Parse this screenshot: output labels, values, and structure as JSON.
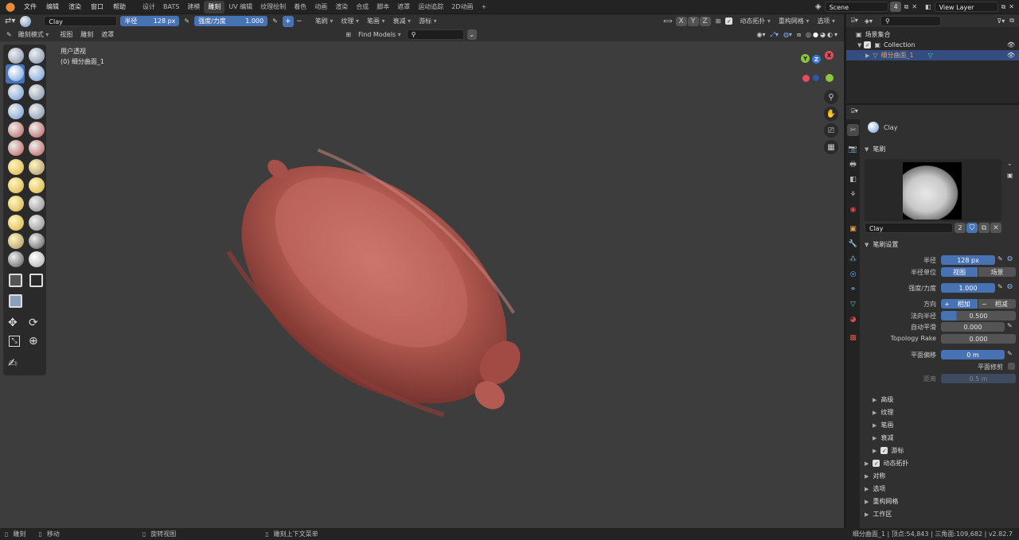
{
  "menu": [
    "文件",
    "编辑",
    "渲染",
    "窗口",
    "帮助"
  ],
  "workspaces": [
    "设计",
    "BATS",
    "建模",
    "雕刻",
    "UV 编辑",
    "纹理绘制",
    "着色",
    "动画",
    "渲染",
    "合成",
    "脚本",
    "遮罩",
    "运动追踪",
    "2D动画"
  ],
  "active_workspace": "雕刻",
  "add_tab": "+",
  "scene": {
    "name": "Scene",
    "count": "4"
  },
  "view_layer": "View Layer",
  "tool_header": {
    "brush_name": "Clay",
    "radius_label": "半径",
    "radius_value": "128 px",
    "strength_label": "强度/力度",
    "strength_value": "1.000",
    "plus": "+",
    "minus": "−",
    "menus": [
      "笔刷",
      "纹理",
      "笔画",
      "衰减",
      "游标"
    ],
    "axes": [
      "X",
      "Y",
      "Z"
    ],
    "dyntopo_label": "动态拓扑",
    "remesh_label": "重构网格",
    "options_label": "选项"
  },
  "viewport_header": {
    "mode": "雕刻模式",
    "menus": [
      "视图",
      "雕刻",
      "遮罩"
    ],
    "find_models": "Find Models"
  },
  "viewport": {
    "view_name": "用户透视",
    "object_name": "(0) 细分曲面_1"
  },
  "gizmo": {
    "x": "X",
    "y": "Y",
    "z": "Z"
  },
  "outliner": {
    "scene_collection": "场景集合",
    "collection": "Collection",
    "object": "细分曲面_1"
  },
  "properties": {
    "brush_name": "Clay",
    "brush_panel": "笔刷",
    "brush_slot_name": "Clay",
    "brush_users": "2",
    "settings_panel": "笔刷设置",
    "rows": {
      "radius": {
        "label": "半径",
        "value": "128 px"
      },
      "radius_unit": {
        "label": "半径单位",
        "options": [
          "视图",
          "场景"
        ]
      },
      "strength": {
        "label": "强度/力度",
        "value": "1.000"
      },
      "direction": {
        "label": "方向",
        "options": [
          "相加",
          "相减"
        ],
        "plus": "+",
        "minus": "−"
      },
      "normal_radius": {
        "label": "法向半径",
        "value": "0.500",
        "fraction": 0.21
      },
      "autosmooth": {
        "label": "自动平滑",
        "value": "0.000"
      },
      "topology_rake": {
        "label": "Topology Rake",
        "value": "0.000"
      },
      "plane_offset": {
        "label": "平面偏移",
        "value": "0 m"
      },
      "plane_trim": {
        "label": "平面修剪"
      },
      "distance": {
        "label": "距离",
        "value": "0.5 m"
      }
    },
    "subpanels": [
      "高级",
      "纹理",
      "笔画",
      "衰减",
      "游标"
    ],
    "panels": [
      "动态拓扑",
      "对称",
      "选项",
      "重构网格",
      "工作区"
    ]
  },
  "status": {
    "left": [
      "雕刻",
      "移动",
      "旋转视图",
      "雕刻上下文菜单"
    ],
    "right": "细分曲面_1 | 顶点:54,843 | 三角面:109,682 | v2.82.7"
  },
  "colors": {
    "accent": "#4772b3",
    "viewport": "#3d3d3d",
    "clay": "#b85a52"
  }
}
